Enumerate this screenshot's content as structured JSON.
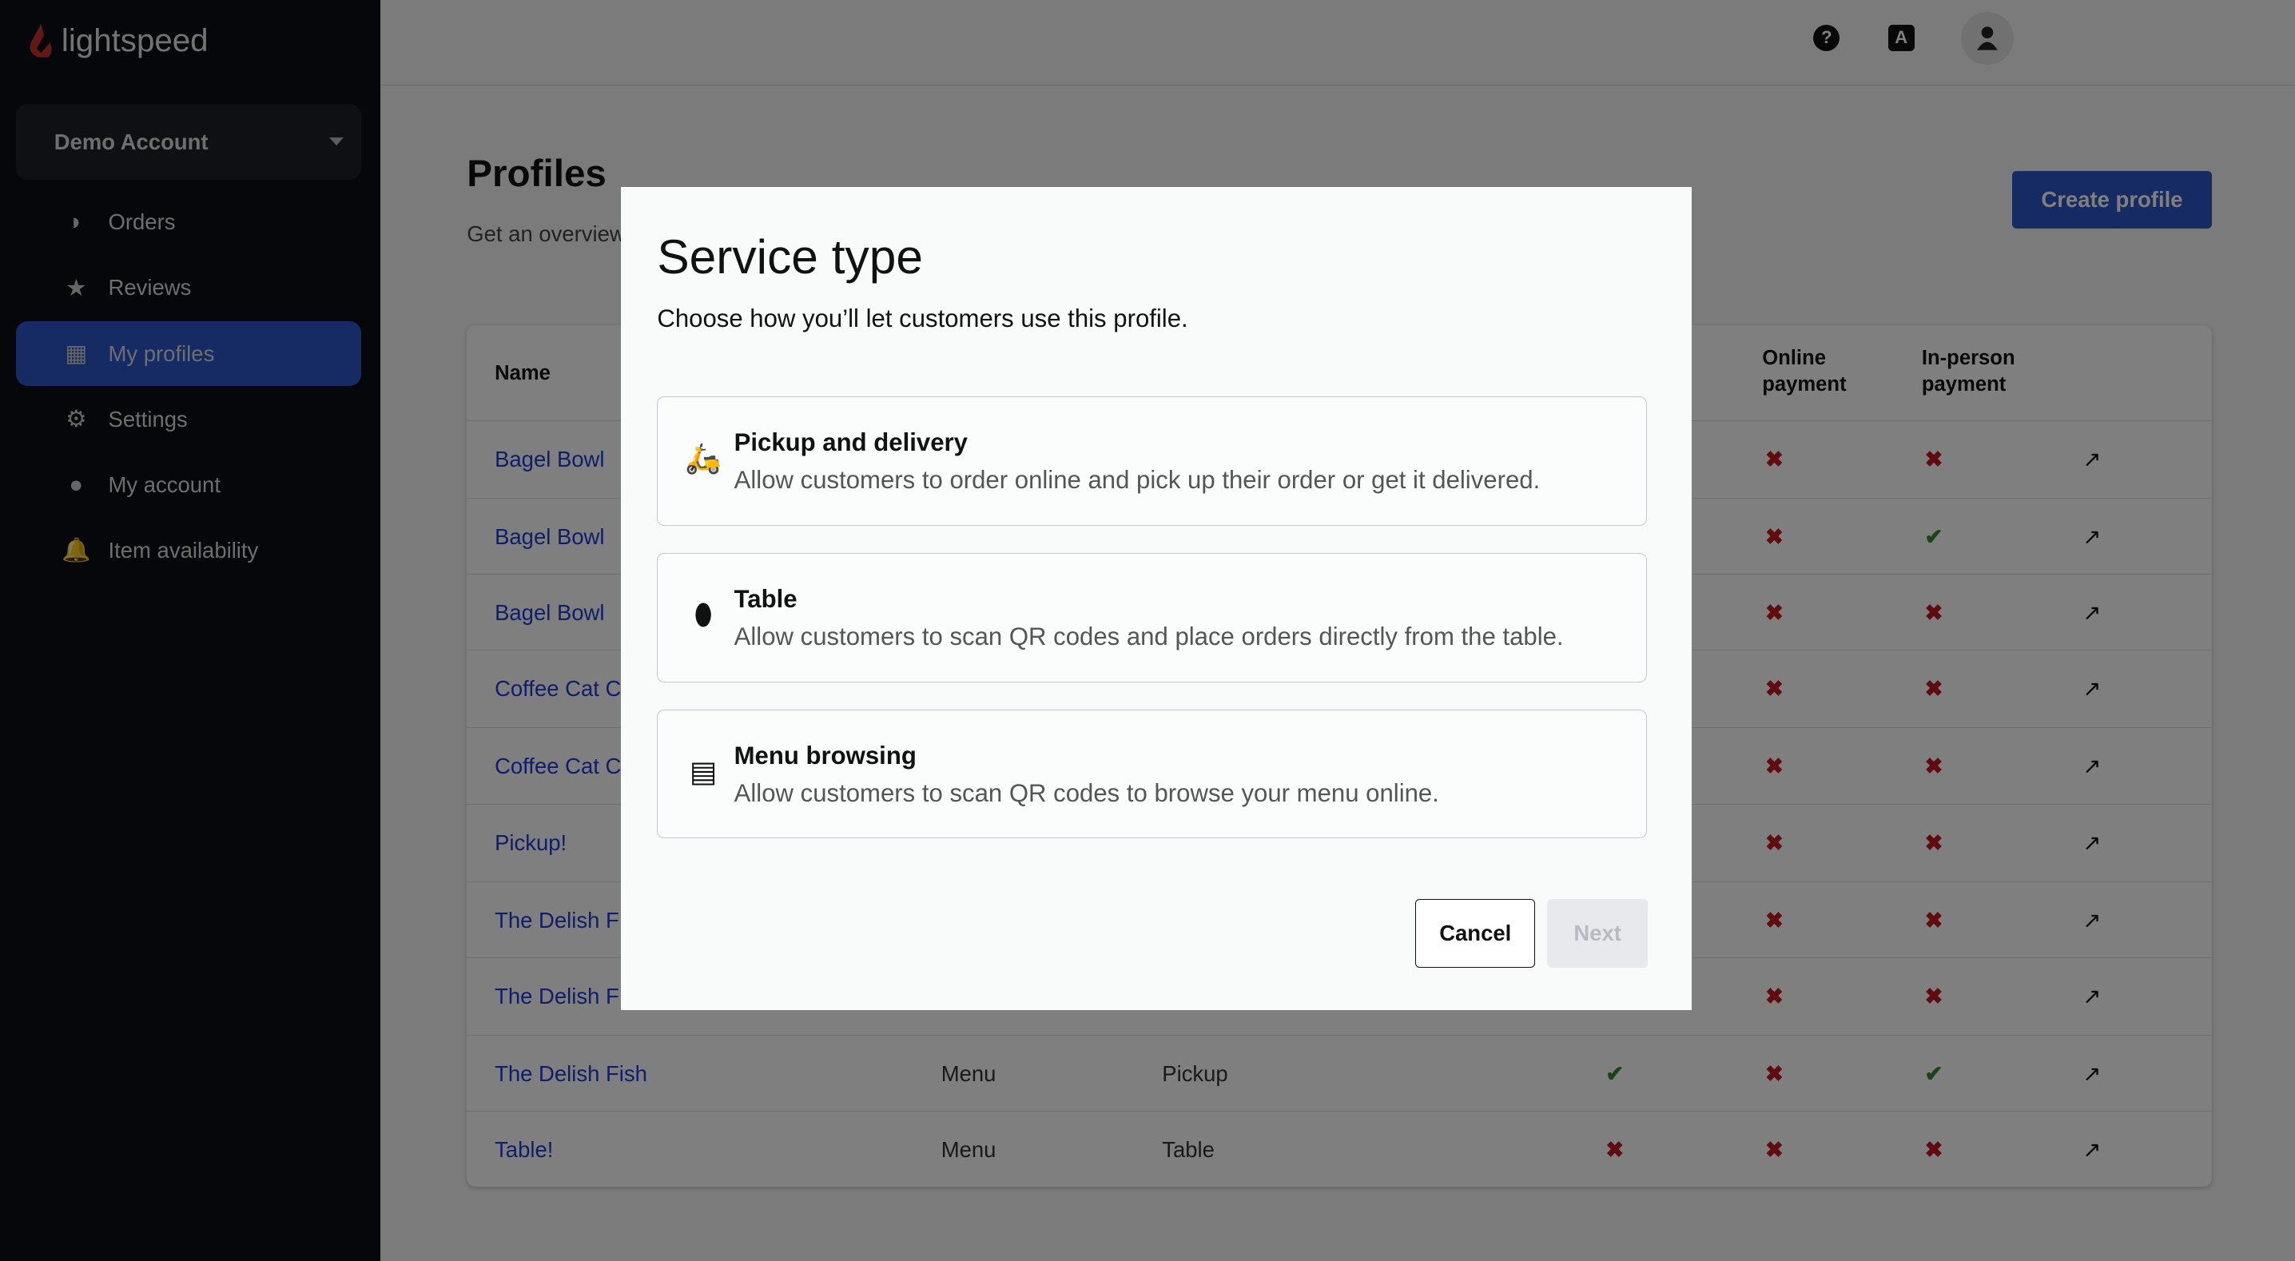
{
  "brand": {
    "name": "lightspeed",
    "color": "#c8302b"
  },
  "sidebar": {
    "account": "Demo Account",
    "items": [
      {
        "label": "Orders",
        "icon": "orders-icon"
      },
      {
        "label": "Reviews",
        "icon": "star-icon"
      },
      {
        "label": "My profiles",
        "icon": "profiles-icon",
        "active": true
      },
      {
        "label": "Settings",
        "icon": "gear-icon"
      },
      {
        "label": "My account",
        "icon": "user-circle-icon"
      },
      {
        "label": "Item availability",
        "icon": "bell-icon"
      }
    ]
  },
  "topbar": {
    "help": "?",
    "lang": "A"
  },
  "page": {
    "title": "Profiles",
    "subtitle": "Get an overview",
    "create_button": "Create profile"
  },
  "table": {
    "headers": {
      "name": "Name",
      "online": "Online payment",
      "inperson": "In-person payment"
    },
    "rows": [
      {
        "name": "Bagel Bowl",
        "online": false,
        "inperson": false
      },
      {
        "name": "Bagel Bowl",
        "online": false,
        "inperson": true
      },
      {
        "name": "Bagel Bowl",
        "online": false,
        "inperson": false
      },
      {
        "name": "Coffee Cat C",
        "online": false,
        "inperson": false
      },
      {
        "name": "Coffee Cat C",
        "online": false,
        "inperson": false
      },
      {
        "name": "Pickup!",
        "online": false,
        "inperson": false
      },
      {
        "name": "The Delish F",
        "online": false,
        "inperson": false
      },
      {
        "name": "The Delish F",
        "online": false,
        "inperson": false
      },
      {
        "name": "The Delish Fish",
        "type": "Menu",
        "service": "Pickup",
        "col4": true,
        "online": false,
        "inperson": true
      },
      {
        "name": "Table!",
        "type": "Menu",
        "service": "Table",
        "col4": false,
        "online": false,
        "inperson": false
      }
    ]
  },
  "modal": {
    "title": "Service type",
    "subtitle": "Choose how you’ll let customers use this profile.",
    "options": [
      {
        "title": "Pickup and delivery",
        "desc": "Allow customers to order online and pick up their order or get it delivered.",
        "icon": "scooter-icon"
      },
      {
        "title": "Table",
        "desc": "Allow customers to scan QR codes and place orders directly from the table.",
        "icon": "table-stand-icon"
      },
      {
        "title": "Menu browsing",
        "desc": "Allow customers to scan QR codes to browse your menu online.",
        "icon": "menu-icon"
      }
    ],
    "cancel": "Cancel",
    "next": "Next"
  }
}
